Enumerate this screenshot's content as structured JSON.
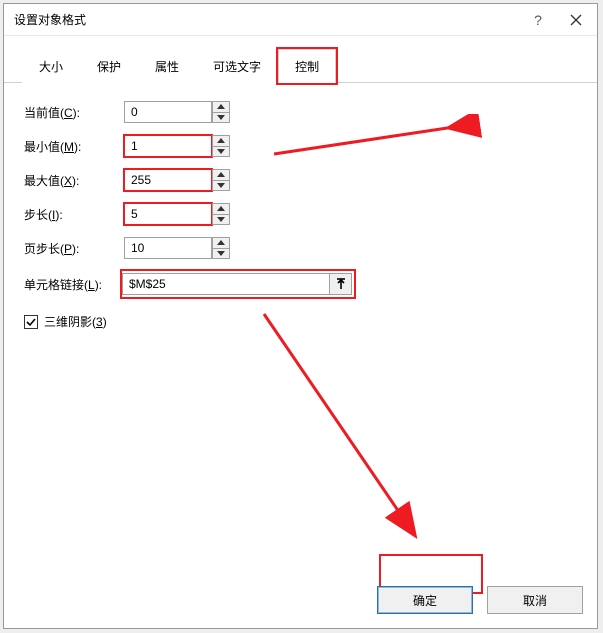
{
  "title": "设置对象格式",
  "tabs": {
    "size": "大小",
    "protect": "保护",
    "properties": "属性",
    "alttext": "可选文字",
    "control": "控制"
  },
  "labels": {
    "current_prefix": "当前值(",
    "current_u": "C",
    "current_suffix": "):",
    "min_prefix": "最小值(",
    "min_u": "M",
    "min_suffix": "):",
    "max_prefix": "最大值(",
    "max_u": "X",
    "max_suffix": "):",
    "step_prefix": "步长(",
    "step_u": "I",
    "step_suffix": "):",
    "page_prefix": "页步长(",
    "page_u": "P",
    "page_suffix": "):",
    "link_prefix": "单元格链接(",
    "link_u": "L",
    "link_suffix": "):",
    "shadow_prefix": "三维阴影(",
    "shadow_u": "3",
    "shadow_suffix": ")"
  },
  "values": {
    "current": "0",
    "min": "1",
    "max": "255",
    "step": "5",
    "page": "10",
    "link": "$M$25"
  },
  "checkbox": {
    "shadow_checked": true
  },
  "buttons": {
    "ok": "确定",
    "cancel": "取消"
  },
  "colors": {
    "highlight": "#ee1b22"
  }
}
